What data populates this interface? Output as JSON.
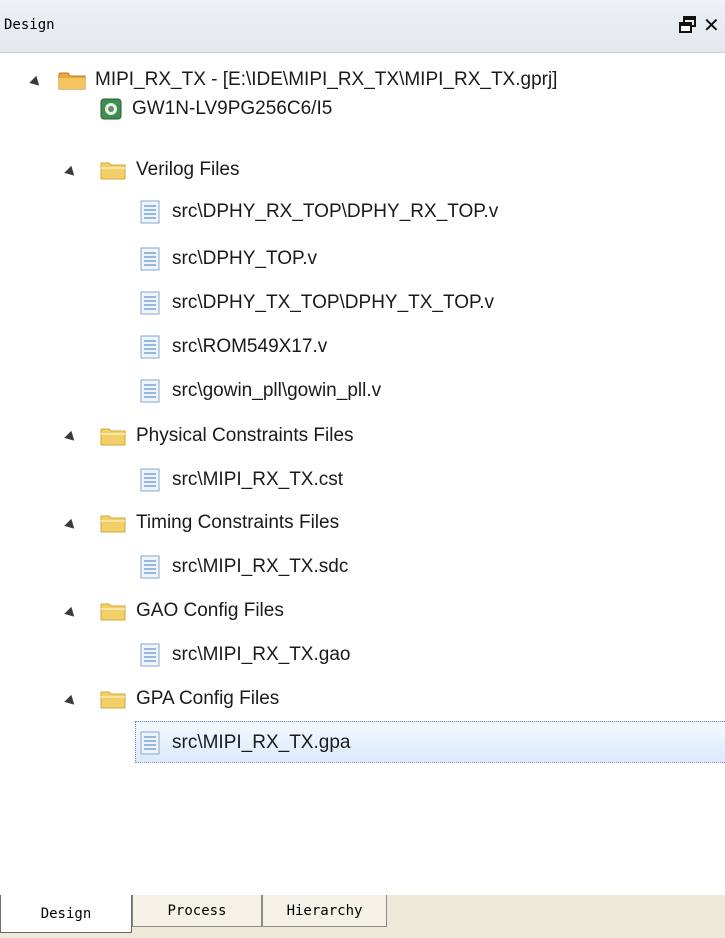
{
  "panel": {
    "title": "Design"
  },
  "tree": {
    "project": "MIPI_RX_TX - [E:\\IDE\\MIPI_RX_TX\\MIPI_RX_TX.gprj]",
    "device": "GW1N-LV9PG256C6/I5",
    "verilog": {
      "label": "Verilog Files",
      "files": [
        "src\\DPHY_RX_TOP\\DPHY_RX_TOP.v",
        "src\\DPHY_TOP.v",
        "src\\DPHY_TX_TOP\\DPHY_TX_TOP.v",
        "src\\ROM549X17.v",
        "src\\gowin_pll\\gowin_pll.v"
      ]
    },
    "physical": {
      "label": "Physical Constraints Files",
      "files": [
        "src\\MIPI_RX_TX.cst"
      ]
    },
    "timing": {
      "label": "Timing Constraints Files",
      "files": [
        "src\\MIPI_RX_TX.sdc"
      ]
    },
    "gao": {
      "label": "GAO Config Files",
      "files": [
        "src\\MIPI_RX_TX.gao"
      ]
    },
    "gpa": {
      "label": "GPA Config Files",
      "files": [
        "src\\MIPI_RX_TX.gpa"
      ]
    }
  },
  "tabs": {
    "design": "Design",
    "process": "Process",
    "hierarchy": "Hierarchy"
  }
}
